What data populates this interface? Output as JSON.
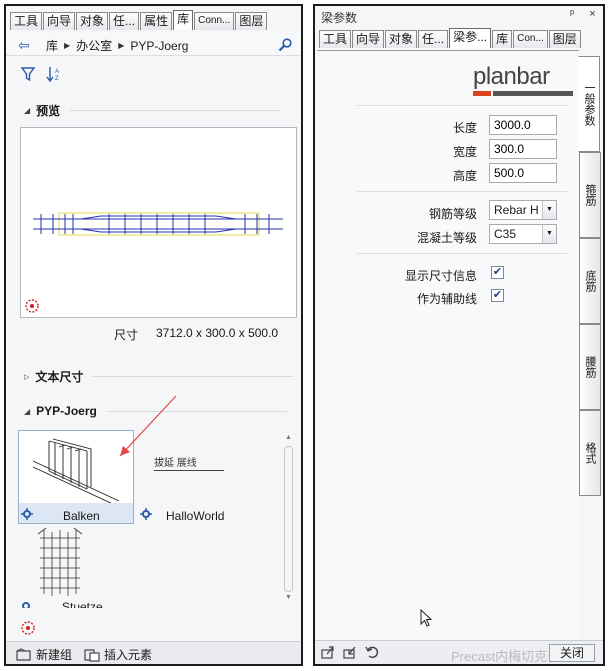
{
  "left": {
    "tabs": [
      "工具",
      "向导",
      "对象",
      "任...",
      "属性",
      "库",
      "Conn...",
      "图层"
    ],
    "active_tab": 5,
    "breadcrumb": [
      "库",
      "办公室",
      "PYP-Joerg"
    ],
    "section_preview": "预览",
    "dim_label": "尺寸",
    "dim_value": "3712.0 x 300.0 x 500.0",
    "section_text_dim": "文本尺寸",
    "section_group": "PYP-Joerg",
    "items": [
      {
        "label": "Balken"
      },
      {
        "label": "HalloWorld",
        "preview_text": "拔延 展线"
      },
      {
        "label": "Stuetze"
      }
    ],
    "bottom": {
      "new_group": "新建组",
      "insert_element": "插入元素"
    }
  },
  "right": {
    "title": "梁参数",
    "title_controls": "ᵖ ×",
    "tabs": [
      "工具",
      "向导",
      "对象",
      "任...",
      "梁参...",
      "库",
      "Con...",
      "图层"
    ],
    "active_tab": 4,
    "vtabs": [
      "一般参数",
      "箍筋",
      "底筋",
      "腰筋",
      "格式"
    ],
    "logo": "planbar",
    "fields": {
      "length_label": "长度",
      "length_value": "3000.0",
      "width_label": "宽度",
      "width_value": "300.0",
      "height_label": "高度",
      "height_value": "500.0",
      "rebar_label": "钢筋等级",
      "rebar_value": "Rebar H",
      "concrete_label": "混凝土等级",
      "concrete_value": "C35",
      "show_dim_label": "显示尺寸信息",
      "show_dim_checked": true,
      "aux_label": "作为辅助线",
      "aux_checked": true
    },
    "watermark": "Precast内梅切克",
    "close_label": "关闭"
  }
}
